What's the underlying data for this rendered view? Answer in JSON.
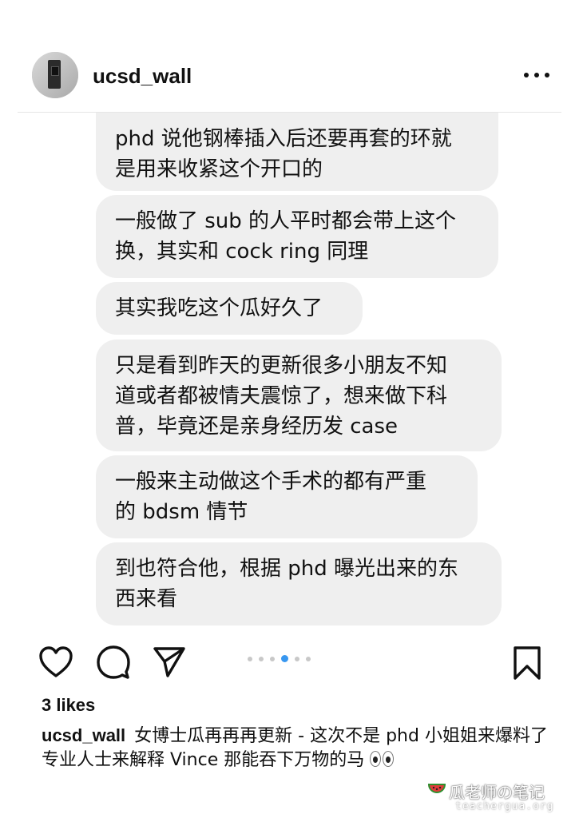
{
  "header": {
    "username": "ucsd_wall",
    "more_icon": "more-horizontal-icon"
  },
  "messages": [
    {
      "text": "phd 说他钢棒插入后还要再套的环就\n是用来收紧这个开口的"
    },
    {
      "text": "一般做了 sub 的人平时都会带上这个\n换，其实和 cock ring 同理"
    },
    {
      "text": "其实我吃这个瓜好久了"
    },
    {
      "text": "只是看到昨天的更新很多小朋友不知\n道或者都被情夫震惊了，想来做下科\n普，毕竟还是亲身经历发 case"
    },
    {
      "text": "一般来主动做这个手术的都有严重\n的 bdsm 情节"
    },
    {
      "text": "到也符合他，根据 phd 曝光出来的东\n西来看"
    }
  ],
  "actions": {
    "like_icon": "heart-icon",
    "comment_icon": "comment-icon",
    "share_icon": "send-icon",
    "save_icon": "bookmark-icon",
    "carousel": {
      "total": 6,
      "active_index": 3,
      "active_color": "#3897f0"
    }
  },
  "likes": "3 likes",
  "caption": {
    "username": "ucsd_wall",
    "text": "女博士瓜再再再更新 - 这次不是 phd 小姐姐来爆料了 专业人士来解释 Vince 那能吞下万物的马"
  },
  "watermark": {
    "text": "瓜老师の笔记",
    "url": "teachergua.org"
  },
  "colors": {
    "bubble": "#efefef",
    "accent": "#3897f0",
    "text": "#111111"
  }
}
